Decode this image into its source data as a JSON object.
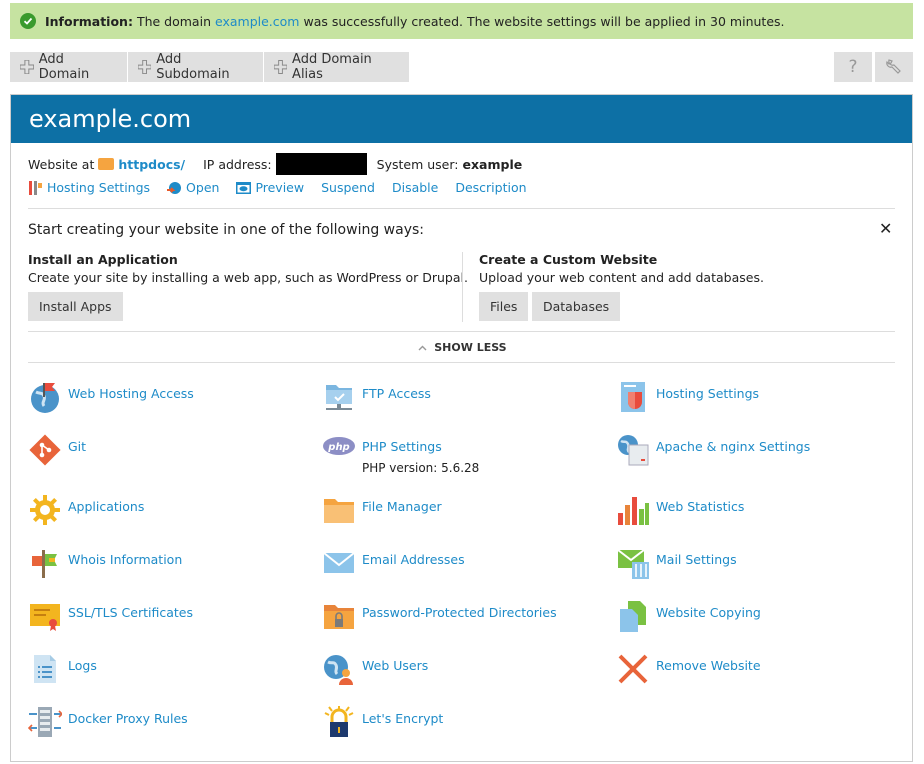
{
  "message": {
    "label": "Information:",
    "text_before": "The domain",
    "domain_link": "example.com",
    "text_after": "was successfully created. The website settings will be applied in 30 minutes."
  },
  "toolbar": {
    "add_domain": "Add Domain",
    "add_subdomain": "Add Subdomain",
    "add_domain_alias": "Add Domain Alias",
    "help_glyph": "?"
  },
  "domain": {
    "name": "example.com",
    "website_at_label": "Website at",
    "docroot": "httpdocs/",
    "ip_label": "IP address:",
    "system_user_label": "System user:",
    "system_user": "example"
  },
  "actions": {
    "hosting_settings": "Hosting Settings",
    "open": "Open",
    "preview": "Preview",
    "suspend": "Suspend",
    "disable": "Disable",
    "description": "Description"
  },
  "start": {
    "title": "Start creating your website in one of the following ways:",
    "close_glyph": "✕",
    "install_title": "Install an Application",
    "install_text": "Create your site by installing a web app, such as WordPress or Drupal.",
    "install_button": "Install Apps",
    "custom_title": "Create a Custom Website",
    "custom_text": "Upload your web content and add databases.",
    "files_button": "Files",
    "databases_button": "Databases",
    "show_less": "SHOW LESS"
  },
  "tools": {
    "web_hosting_access": "Web Hosting Access",
    "ftp_access": "FTP Access",
    "hosting_settings": "Hosting Settings",
    "git": "Git",
    "php_settings": "PHP Settings",
    "php_version": "PHP version: 5.6.28",
    "apache_nginx": "Apache & nginx Settings",
    "applications": "Applications",
    "file_manager": "File Manager",
    "web_statistics": "Web Statistics",
    "whois": "Whois Information",
    "email_addresses": "Email Addresses",
    "mail_settings": "Mail Settings",
    "ssl": "SSL/TLS Certificates",
    "password_dirs": "Password-Protected Directories",
    "website_copying": "Website Copying",
    "logs": "Logs",
    "web_users": "Web Users",
    "remove_website": "Remove Website",
    "docker_proxy": "Docker Proxy Rules",
    "lets_encrypt": "Let's Encrypt",
    "php_badge": "php"
  },
  "colors": {
    "accent": "#0d70a5",
    "link": "#1e8bc8",
    "success_bg": "#c6e3a1",
    "button_bg": "#e0e0e0"
  }
}
